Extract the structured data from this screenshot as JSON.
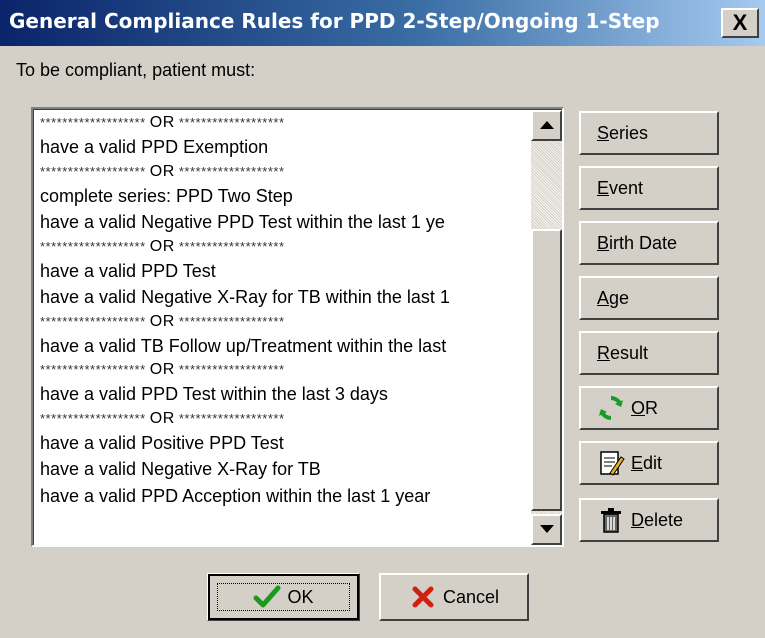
{
  "window": {
    "title": "General Compliance Rules for PPD 2-Step/Ongoing 1-Step",
    "close_label": "X"
  },
  "instructions": "To be compliant, patient must:",
  "separator": {
    "stars": "*******************",
    "or": "OR"
  },
  "rules": [
    {
      "type": "sep"
    },
    {
      "type": "rule",
      "text": "have a valid PPD Exemption"
    },
    {
      "type": "sep"
    },
    {
      "type": "rule",
      "text": "complete series: PPD Two Step"
    },
    {
      "type": "rule",
      "text": "have a valid Negative PPD Test within the last 1 ye"
    },
    {
      "type": "sep"
    },
    {
      "type": "rule",
      "text": "have a valid PPD Test"
    },
    {
      "type": "rule",
      "text": "have a valid Negative X-Ray for TB within the last 1"
    },
    {
      "type": "sep"
    },
    {
      "type": "rule",
      "text": "have a valid TB Follow up/Treatment within the last"
    },
    {
      "type": "sep"
    },
    {
      "type": "rule",
      "text": "have a valid  PPD Test within the last 3 days"
    },
    {
      "type": "sep"
    },
    {
      "type": "rule",
      "text": "have a valid Positive PPD Test"
    },
    {
      "type": "rule",
      "text": "have a valid Negative X-Ray for TB"
    },
    {
      "type": "rule",
      "text": "have a valid PPD Acception within the last 1 year"
    }
  ],
  "side_buttons": [
    {
      "key": "S",
      "rest": "eries",
      "icon": null
    },
    {
      "key": "E",
      "rest": "vent",
      "icon": null
    },
    {
      "key": "B",
      "rest": "irth Date",
      "icon": null
    },
    {
      "key": "A",
      "rest": "ge",
      "icon": null
    },
    {
      "key": "R",
      "rest": "esult",
      "icon": null
    },
    {
      "key": "O",
      "rest": "R",
      "icon": "refresh-icon"
    },
    {
      "key": "E",
      "rest": "dit",
      "icon": "edit-document-icon"
    },
    {
      "key": "D",
      "rest": "elete",
      "icon": "trash-icon"
    }
  ],
  "footer": {
    "ok_label": "OK",
    "cancel_label": "Cancel"
  },
  "colors": {
    "title_gradient_start": "#0a246a",
    "title_gradient_end": "#a6caf0",
    "dialog_bg": "#d4d0c8",
    "ok_check": "#1a9a1a",
    "cancel_x": "#d02010",
    "refresh": "#1a9a2a"
  }
}
